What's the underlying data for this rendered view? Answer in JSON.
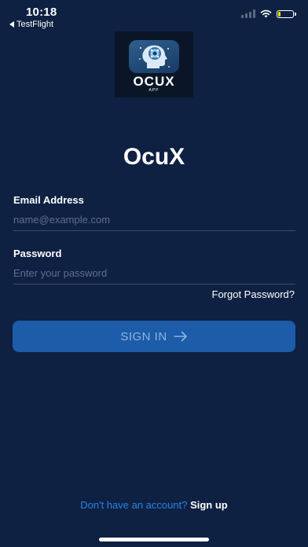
{
  "status_bar": {
    "time": "10:18",
    "back_app": "TestFlight",
    "battery_color": "#f5d90a"
  },
  "logo": {
    "name": "OCUX",
    "subtitle": "APP",
    "icon": "brain-head-icon"
  },
  "title": "OcuX",
  "form": {
    "email_label": "Email Address",
    "email_placeholder": "name@example.com",
    "email_value": "",
    "password_label": "Password",
    "password_placeholder": "Enter your password",
    "password_value": "",
    "forgot_label": "Forgot Password?",
    "signin_label": "SIGN IN",
    "signin_icon": "arrow-right-icon"
  },
  "footer": {
    "prompt": "Don't have an account?",
    "signup_label": "Sign up"
  },
  "colors": {
    "background": "#0e2142",
    "button": "#1c5ca8",
    "link": "#2a83e6"
  }
}
